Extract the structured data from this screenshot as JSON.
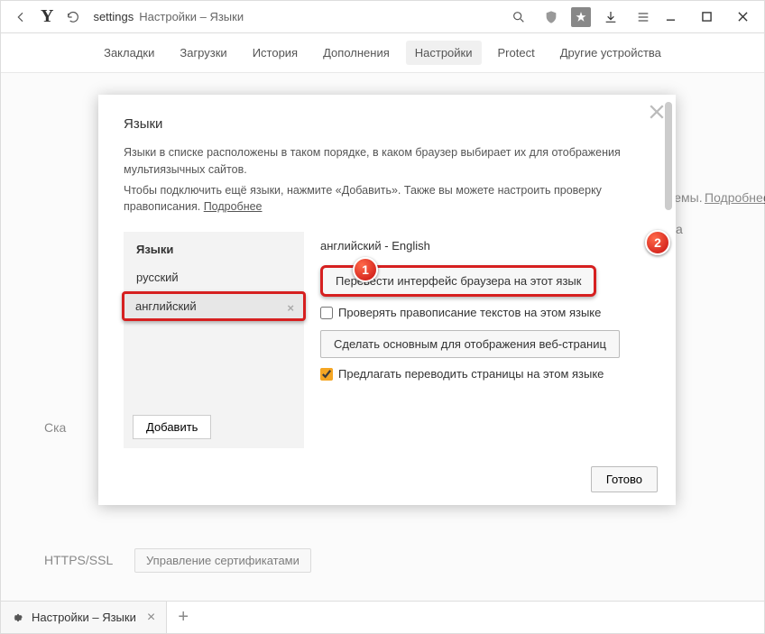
{
  "toolbar": {
    "address_prefix": "settings",
    "address_title": "Настройки – Языки"
  },
  "pagetabs": {
    "bookmarks": "Закладки",
    "downloads": "Загрузки",
    "history": "История",
    "addons": "Дополнения",
    "settings": "Настройки",
    "protect": "Protect",
    "devices": "Другие устройства"
  },
  "background": {
    "label_ska": "Ска",
    "link_more": "Подробнее",
    "label_a": "а",
    "label_temy": "темы.",
    "https": "HTTPS/SSL",
    "certbtn": "Управление сертификатами"
  },
  "modal": {
    "title": "Языки",
    "desc1": "Языки в списке расположены в таком порядке, в каком браузер выбирает их для отображения мультиязычных сайтов.",
    "desc2a": "Чтобы подключить ещё языки, нажмите «Добавить». Также вы можете настроить проверку правописания. ",
    "desc2_link": "Подробнее",
    "list_header": "Языки",
    "lang_ru": "русский",
    "lang_en": "английский",
    "add": "Добавить",
    "detail_title": "английский - English",
    "btn_translate_ui": "Перевести интерфейс браузера на этот язык",
    "chk_spellcheck": "Проверять правописание текстов на этом языке",
    "btn_main_display": "Сделать основным для отображения веб-страниц",
    "chk_offer_translate": "Предлагать переводить страницы на этом языке",
    "done": "Готово"
  },
  "callouts": {
    "one": "1",
    "two": "2"
  },
  "tabstrip": {
    "tab_title": "Настройки – Языки"
  }
}
